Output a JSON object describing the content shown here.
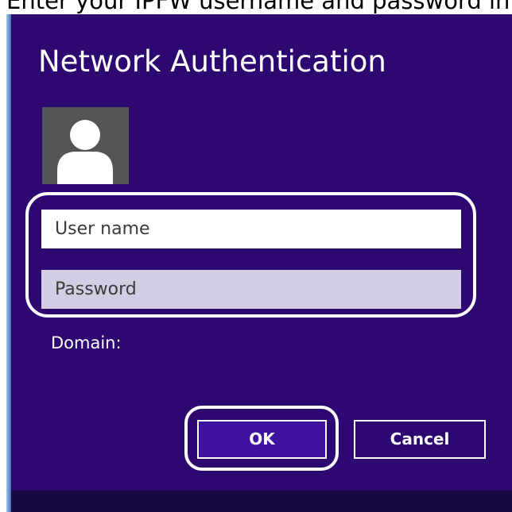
{
  "caption": "Enter your IPFW username and password in the",
  "dialog": {
    "title": "Network Authentication",
    "avatar_icon": "user-avatar-icon",
    "username_placeholder": "User name",
    "password_placeholder": "Password",
    "domain_label": "Domain:",
    "ok_label": "OK",
    "cancel_label": "Cancel"
  },
  "colors": {
    "dialog_background": "#2e0871",
    "ok_button": "#3d139f",
    "password_field": "#d3cde3",
    "highlight_outline": "#ffffff"
  }
}
